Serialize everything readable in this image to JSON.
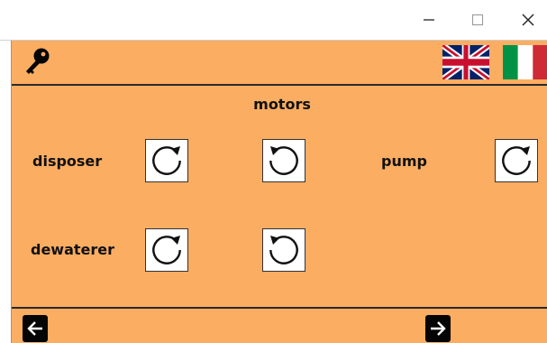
{
  "window": {
    "controls": [
      {
        "name": "minimize",
        "icon": "minimize-icon"
      },
      {
        "name": "maximize",
        "icon": "maximize-icon"
      },
      {
        "name": "close",
        "icon": "close-icon"
      }
    ]
  },
  "header": {
    "icons": [
      "key-icon",
      "uk-flag-icon",
      "italy-flag-icon"
    ]
  },
  "main": {
    "title": "motors",
    "motors": [
      {
        "label": "disposer",
        "buttons": [
          "rotate-clockwise-icon",
          "rotate-counterclockwise-icon"
        ]
      },
      {
        "label": "dewaterer",
        "buttons": [
          "rotate-clockwise-icon",
          "rotate-counterclockwise-icon"
        ]
      },
      {
        "label": "pump",
        "buttons": [
          "rotate-clockwise-icon"
        ]
      }
    ]
  },
  "footer": {
    "icons": [
      "arrow-left-icon",
      "arrow-right-icon"
    ]
  },
  "colors": {
    "background": "#fbad62",
    "button_bg": "#ffffff",
    "dark": "#050505"
  }
}
